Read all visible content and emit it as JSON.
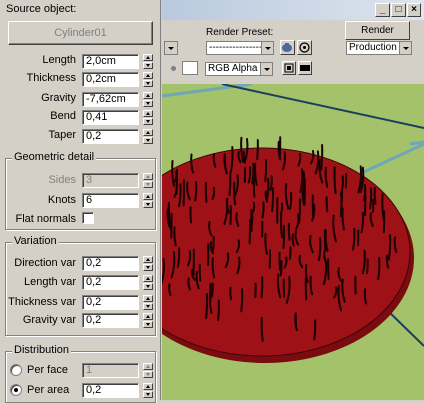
{
  "source": {
    "header": "Source object:",
    "button": "Cylinder01"
  },
  "params": [
    {
      "label": "Length",
      "value": "2,0cm"
    },
    {
      "label": "Thickness",
      "value": "0,2cm"
    },
    {
      "label": "Gravity",
      "value": "-7,62cm"
    },
    {
      "label": "Bend",
      "value": "0,41"
    },
    {
      "label": "Taper",
      "value": "0,2"
    }
  ],
  "geometric": {
    "title": "Geometric detail",
    "sides_label": "Sides",
    "sides_value": "3",
    "knots_label": "Knots",
    "knots_value": "6",
    "flat_label": "Flat normals"
  },
  "variation": {
    "title": "Variation",
    "items": [
      {
        "label": "Direction var",
        "value": "0,2"
      },
      {
        "label": "Length var",
        "value": "0,2"
      },
      {
        "label": "Thickness var",
        "value": "0,2"
      },
      {
        "label": "Gravity var",
        "value": "0,2"
      }
    ]
  },
  "distribution": {
    "title": "Distribution",
    "per_face_label": "Per face",
    "per_face_value": "1",
    "per_area_label": "Per area",
    "per_area_value": "0,2"
  },
  "render": {
    "preset_label": "Render Preset:",
    "preset_value": "--------------------",
    "render_button": "Render",
    "mode_value": "Production",
    "channel_value": "RGB Alpha"
  },
  "colors": {
    "ellipse": "#9e1117",
    "ellipse_rim": "#7a0c10",
    "ground": "#a3c26a",
    "line": "#1a3f5c"
  }
}
